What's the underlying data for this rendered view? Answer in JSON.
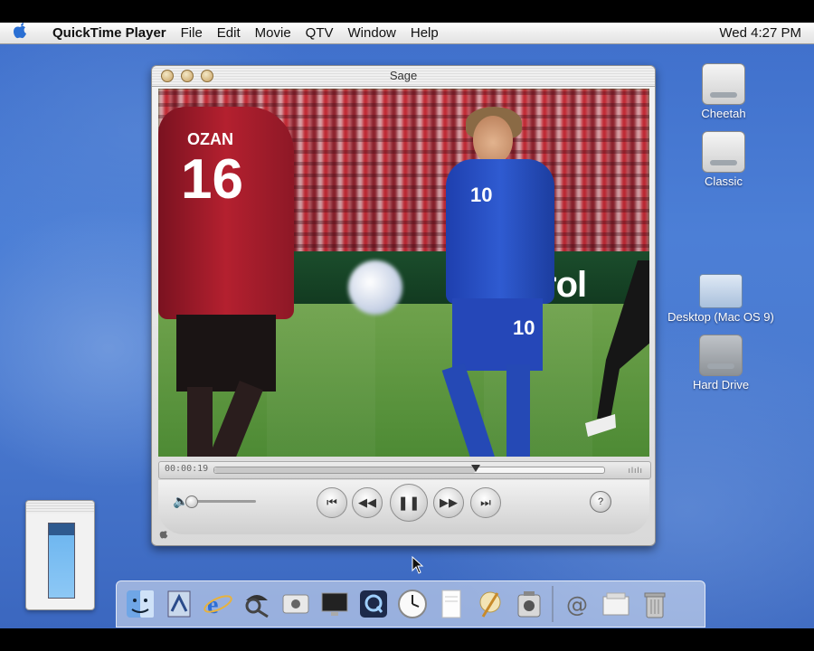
{
  "menubar": {
    "apple_icon": "apple-icon",
    "app_name": "QuickTime Player",
    "menus": [
      "File",
      "Edit",
      "Movie",
      "QTV",
      "Window",
      "Help"
    ],
    "clock": "Wed 4:27 PM"
  },
  "desktop": {
    "icons": [
      {
        "label": "Cheetah",
        "icon": "hard-disk-icon"
      },
      {
        "label": "Classic",
        "icon": "hard-disk-icon"
      },
      {
        "label": "Desktop (Mac OS 9)",
        "icon": "folder-icon"
      },
      {
        "label": "Hard Drive",
        "icon": "hard-disk-icon"
      }
    ]
  },
  "player": {
    "window_title": "Sage",
    "video": {
      "left_jersey_name": "OZAN",
      "left_jersey_number": "16",
      "right_jersey_number": "10",
      "ad_board_text": "rol"
    },
    "timecode": "00:00:19",
    "progress": 0.67,
    "volume": 0.0,
    "controls": {
      "go_to_start": "⏮",
      "rewind": "◀◀",
      "pause": "❚❚",
      "fast_forward": "▶▶",
      "go_to_end": "⏭",
      "speaker_icon": "🔈",
      "help_icon": "?"
    }
  },
  "dock": {
    "items": [
      "finder-icon",
      "mail-icon",
      "internet-explorer-icon",
      "sherlock-icon",
      "apple-system-prefs-icon",
      "monitor-icon",
      "quicktime-icon",
      "clock-icon",
      "textedit-icon",
      "pencil-icon",
      "app-icon",
      "at-sign-icon",
      "documents-icon",
      "trash-icon"
    ]
  },
  "colors": {
    "desktop_blue": "#4a7ad0",
    "menubar": "#eeeeee"
  }
}
